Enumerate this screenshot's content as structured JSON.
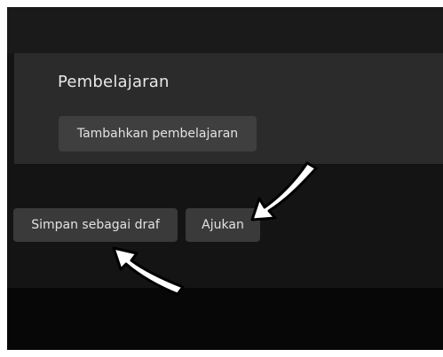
{
  "section": {
    "title": "Pembelajaran",
    "add_button_label": "Tambahkan pembelajaran"
  },
  "actions": {
    "save_draft_label": "Simpan sebagai draf",
    "submit_label": "Ajukan"
  },
  "annotations": {
    "arrow_color": "#ffffff",
    "arrow_outline": "#000000"
  }
}
